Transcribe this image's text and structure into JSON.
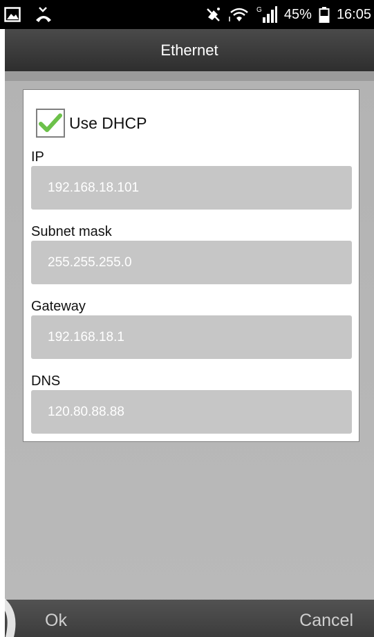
{
  "status_bar": {
    "battery": "45%",
    "time": "16:05",
    "network": "G",
    "icons": [
      "picture-icon",
      "missed-call-icon",
      "mute-icon",
      "wifi-icon",
      "signal-icon",
      "battery-icon"
    ]
  },
  "title": "Ethernet",
  "dhcp": {
    "label": "Use DHCP",
    "checked": true
  },
  "fields": {
    "ip": {
      "label": "IP",
      "value": "192.168.18.101"
    },
    "subnet": {
      "label": "Subnet mask",
      "value": "255.255.255.0"
    },
    "gateway": {
      "label": "Gateway",
      "value": "192.168.18.1"
    },
    "dns": {
      "label": "DNS",
      "value": "120.80.88.88"
    }
  },
  "buttons": {
    "ok": "Ok",
    "cancel": "Cancel"
  },
  "colors": {
    "check": "#6cc14a",
    "field_bg": "#c6c6c6",
    "main_bg": "#b5b5b5"
  }
}
